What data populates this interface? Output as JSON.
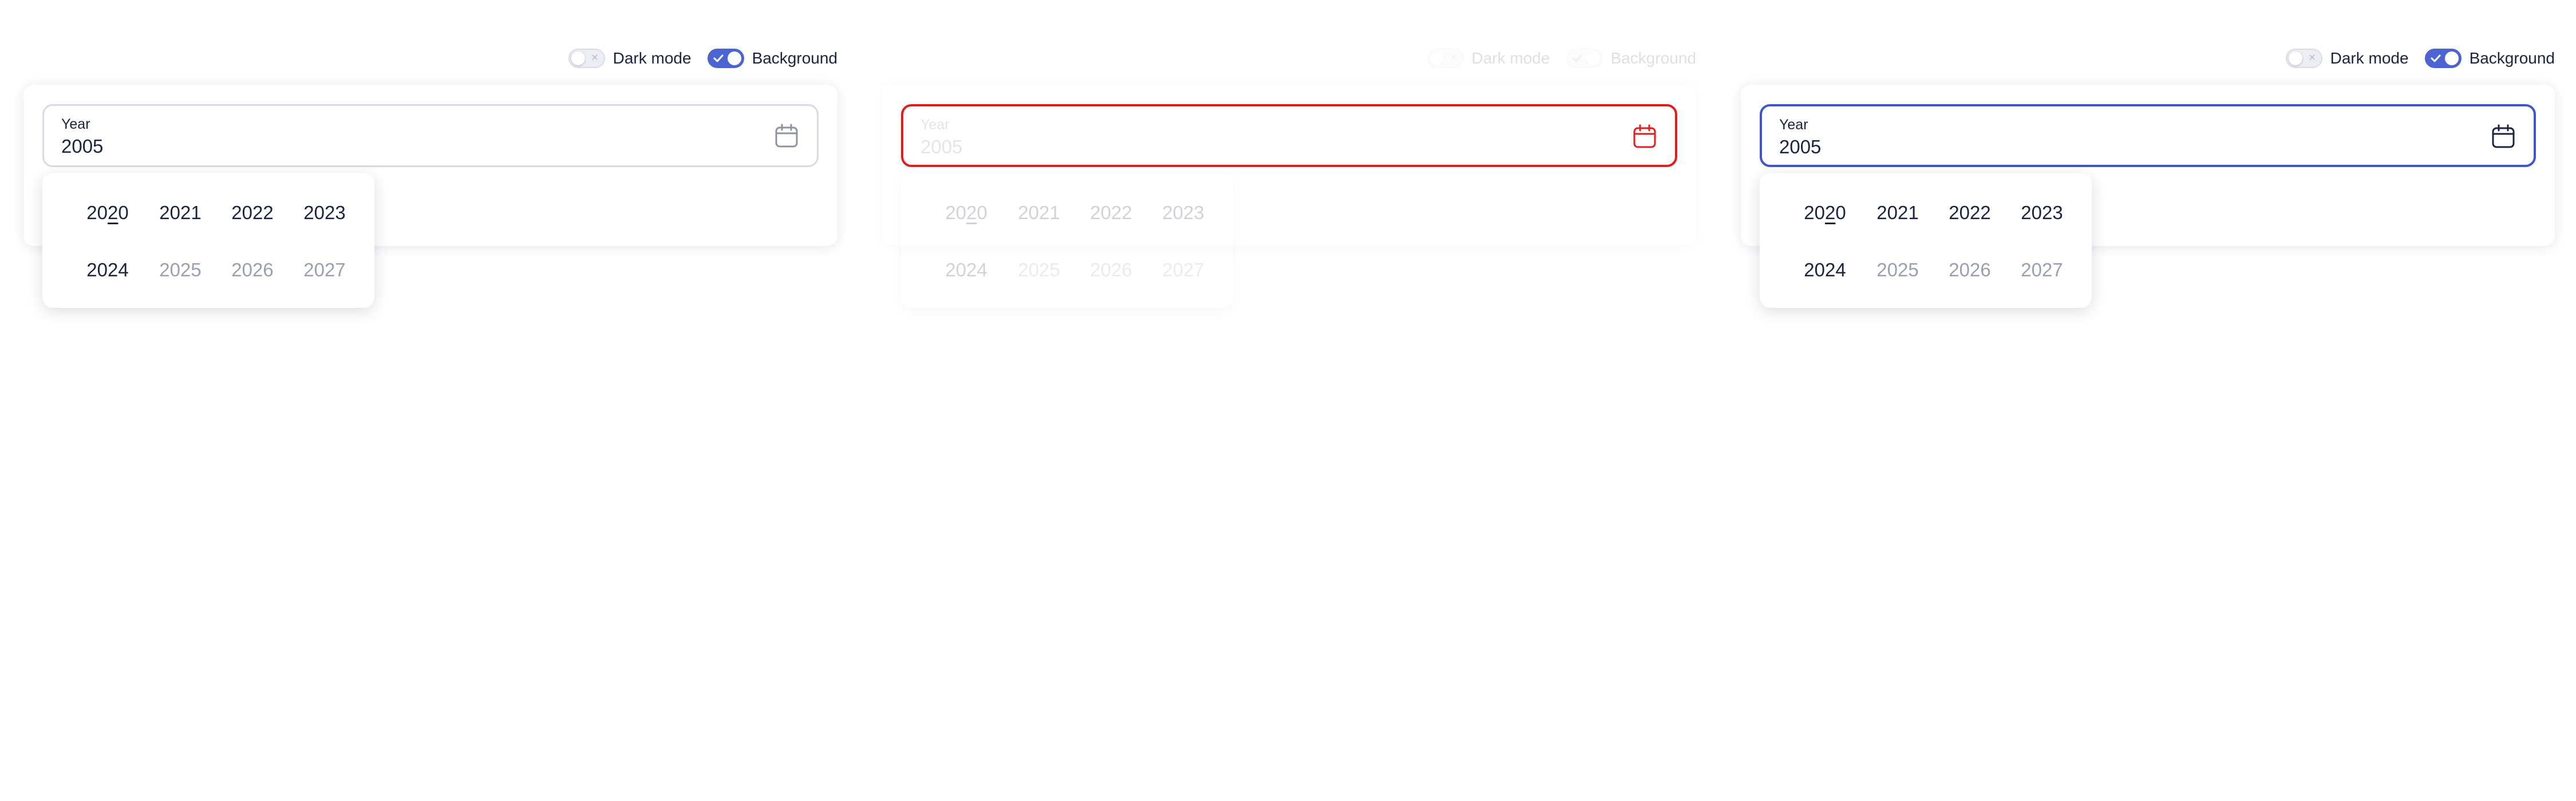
{
  "panels": [
    {
      "state": "default",
      "toggles": {
        "dark_mode_label": "Dark mode",
        "background_label": "Background",
        "dark_mode_on": false,
        "background_on": true
      },
      "field": {
        "label": "Year",
        "value": "2005"
      },
      "years": [
        "2020",
        "2021",
        "2022",
        "2023",
        "2024",
        "2025",
        "2026",
        "2027"
      ],
      "current_year": "2020"
    },
    {
      "state": "error-disabled",
      "toggles": {
        "dark_mode_label": "Dark mode",
        "background_label": "Background",
        "dark_mode_on": false,
        "background_on": false
      },
      "field": {
        "label": "Year",
        "value": "2005"
      },
      "years": [
        "2020",
        "2021",
        "2022",
        "2023",
        "2024",
        "2025",
        "2026",
        "2027"
      ],
      "current_year": "2020"
    },
    {
      "state": "focused",
      "toggles": {
        "dark_mode_label": "Dark mode",
        "background_label": "Background",
        "dark_mode_on": false,
        "background_on": true
      },
      "field": {
        "label": "Year",
        "value": "2005"
      },
      "years": [
        "2020",
        "2021",
        "2022",
        "2023",
        "2024",
        "2025",
        "2026",
        "2027"
      ],
      "current_year": "2020"
    }
  ],
  "colors": {
    "accent": "#4c63d2",
    "error": "#e31c1c",
    "focus_border": "#3f56c6",
    "text": "#1c2340",
    "muted_text": "#9aa0ae"
  },
  "icons": {
    "field_icon": "calendar-icon",
    "toggle_on": "check-icon",
    "toggle_off": "x-icon"
  }
}
